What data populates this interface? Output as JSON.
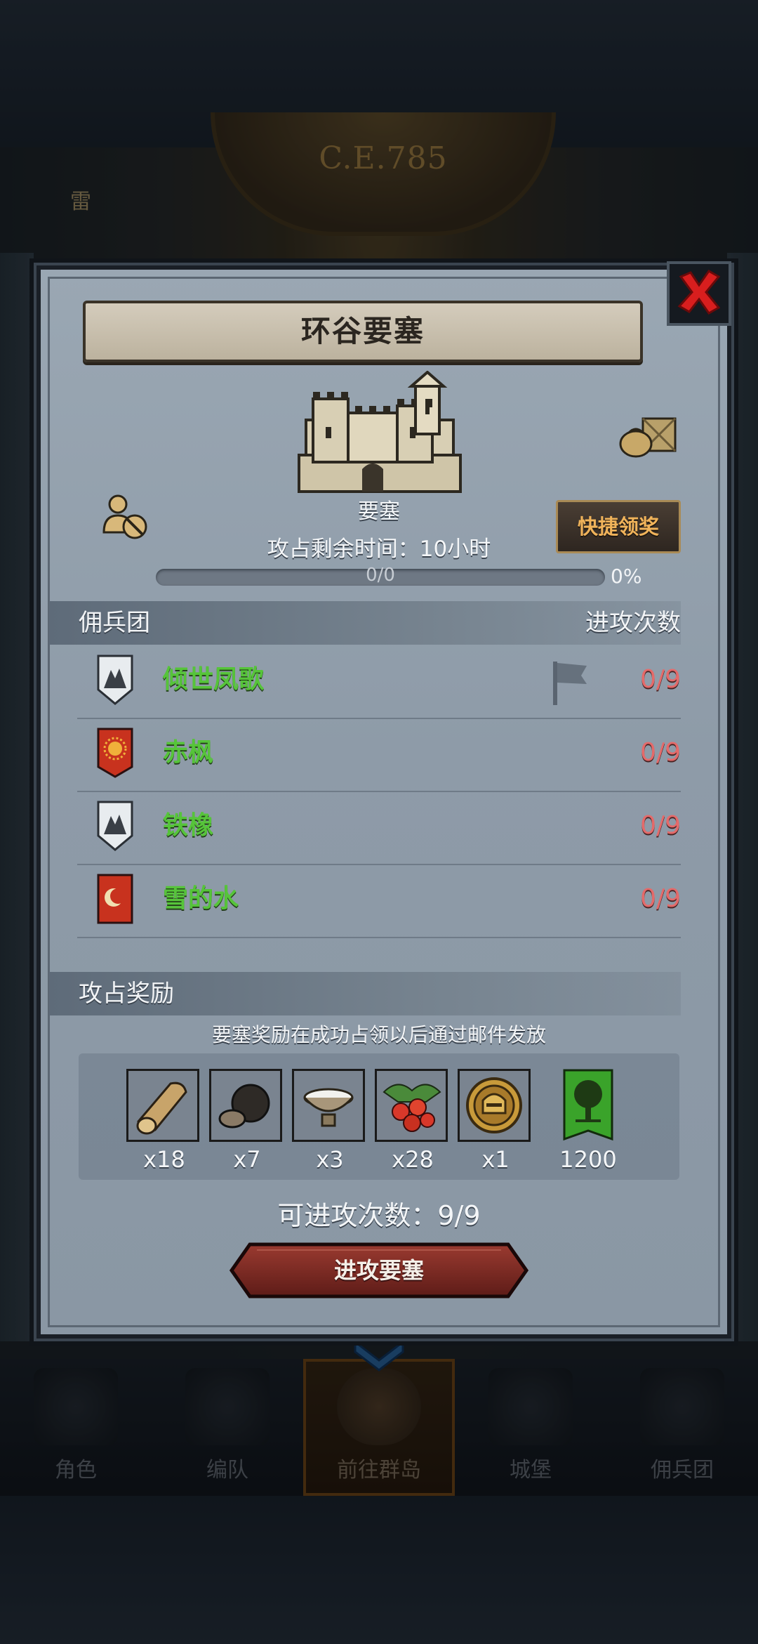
{
  "background": {
    "era": "C.E.785",
    "thunder_label": "雷"
  },
  "bottom_nav": [
    {
      "label": "角色",
      "icon": "character-icon"
    },
    {
      "label": "编队",
      "icon": "formation-icon"
    },
    {
      "label": "前往群岛",
      "icon": "archipelago-icon",
      "active": true
    },
    {
      "label": "城堡",
      "icon": "castle-icon"
    },
    {
      "label": "佣兵团",
      "icon": "mercenary-icon"
    }
  ],
  "dialog": {
    "title": "环谷要塞",
    "fortress_label": "要塞",
    "timer": "攻占剩余时间：10小时",
    "quick_claim": "快捷领奖",
    "progress": {
      "text": "0/0",
      "percent_label": "0%",
      "fraction": 0
    },
    "guild_header": {
      "left": "佣兵团",
      "right": "进攻次数"
    },
    "guilds": [
      {
        "name": "倾世凤歌",
        "count": "0/9",
        "emblem": "white-shield-emblem"
      },
      {
        "name": "赤枫",
        "count": "0/9",
        "emblem": "red-sun-banner-emblem"
      },
      {
        "name": "铁橡",
        "count": "0/9",
        "emblem": "white-shield-emblem"
      },
      {
        "name": "雪的水",
        "count": "0/9",
        "emblem": "red-crescent-banner-emblem"
      }
    ],
    "reward_header": "攻占奖励",
    "reward_note": "要塞奖励在成功占领以后通过邮件发放",
    "rewards": [
      {
        "item": "wood-log",
        "qty": "x18"
      },
      {
        "item": "truffle",
        "qty": "x7"
      },
      {
        "item": "milk-bowl",
        "qty": "x3"
      },
      {
        "item": "berries",
        "qty": "x28"
      },
      {
        "item": "gold-helmet-medal",
        "qty": "x1"
      },
      {
        "item": "green-tree-banner",
        "qty": "1200"
      }
    ],
    "attempts": "可进攻次数：9/9",
    "attack_button": "进攻要塞"
  },
  "colors": {
    "guild_name": "#56c43a",
    "attack_count": "#e46a6a",
    "quick_claim_text": "#f0b35a",
    "close_x": "#d81e1e"
  }
}
